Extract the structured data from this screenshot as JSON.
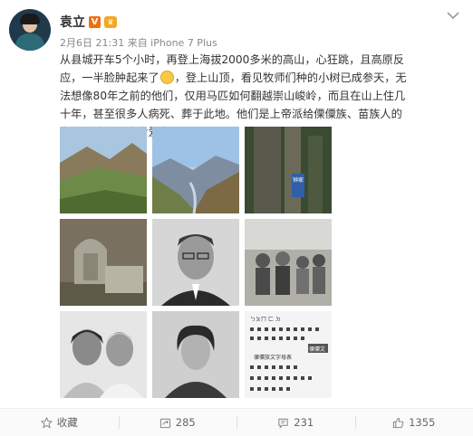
{
  "post": {
    "author": "袁立",
    "verified_badge": "V",
    "meta": "2月6日 21:31 来自 iPhone 7 Plus",
    "text_parts": [
      "从县城开车5个小时，再登上海拔2000多米的高山，心狂跳，且高原反应，一半脸肿起来了",
      "，登上山顶，看见牧师们种的小树已成参天，无法想像80年之前的他们，仅用马匹如何翻越崇山峻岭，而且在山上住几十年，甚至很多人病死、葬于此地。他们是上帝派给傈僳族、苗族人的老师，他们用生命爱中国！"
    ],
    "emoji": "face-emoji",
    "images": [
      "mountain-landscape-photo",
      "mountain-valley-photo",
      "old-tree-sign-photo",
      "stone-tomb-photo",
      "man-portrait-photo",
      "group-outdoor-photo",
      "couple-photo",
      "woman-portrait-photo",
      "alphabet-document-photo"
    ],
    "image_texts": {
      "tree_sign": "钟家",
      "doc_title": "ㄅㄆㄇ ㄈ ㄉ",
      "doc_stamp": "傈僳文",
      "doc_caption": "傈僳族文字母表"
    }
  },
  "actions": {
    "favorite": "收藏",
    "repost": "285",
    "comment": "231",
    "like": "1355"
  },
  "colors": {
    "accent": "#f26e0c",
    "text": "#333333",
    "muted": "#888888"
  }
}
